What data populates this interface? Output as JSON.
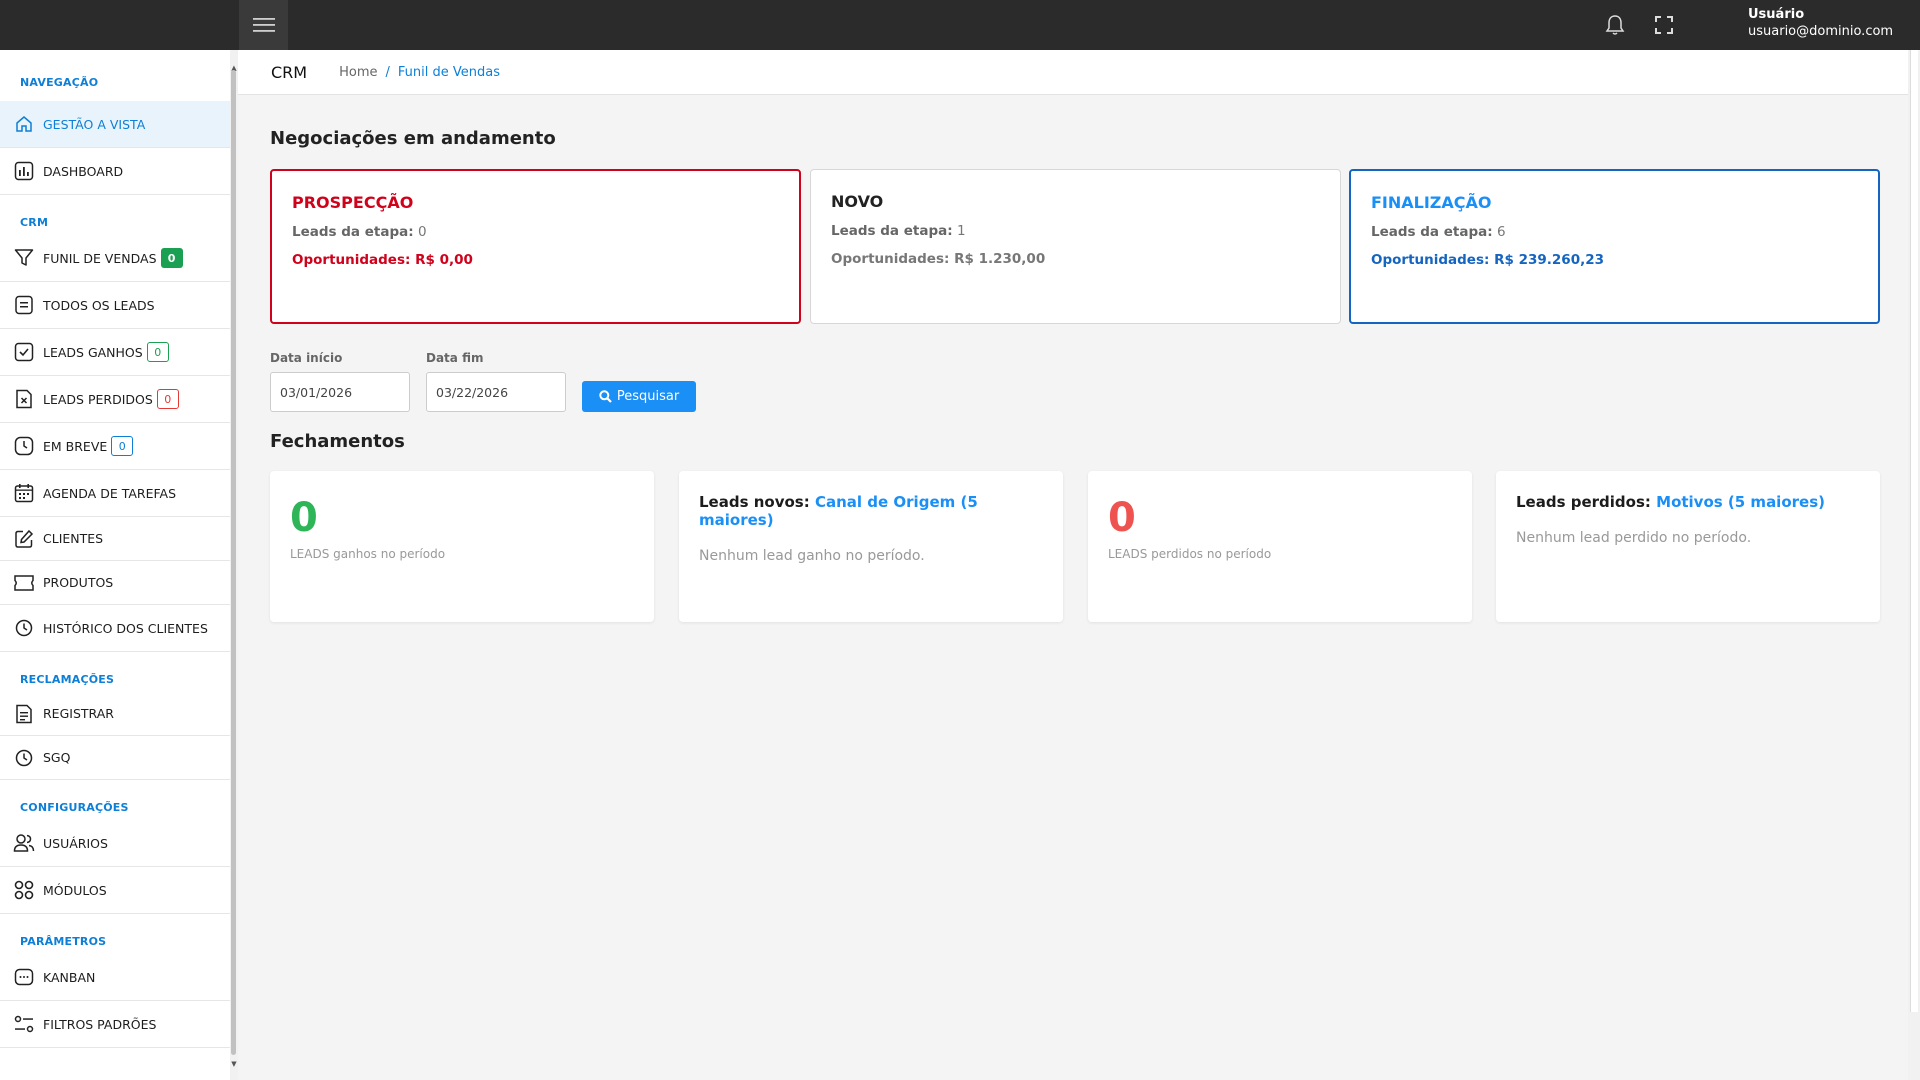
{
  "topbar": {
    "user_name": "Usuário",
    "user_email": "usuario@dominio.com",
    "icons": [
      "menu-icon",
      "bell-icon",
      "fullscreen-icon"
    ]
  },
  "sidebar": {
    "sections": {
      "navegacao": "NAVEGAÇÃO",
      "crm": "CRM",
      "reclamacoes": "RECLAMAÇÕES",
      "configuracoes": "CONFIGURAÇÕES",
      "parametros": "PARÂMETROS"
    },
    "items": {
      "gestao": "GESTÃO A VISTA",
      "dashboard": "DASHBOARD",
      "funil": "FUNIL DE VENDAS",
      "todos_leads": "TODOS OS LEADS",
      "leads_ganhos": "LEADS GANHOS",
      "leads_perdidos": "LEADS PERDIDOS",
      "em_breve": "EM BREVE",
      "agenda": "AGENDA DE TAREFAS",
      "clientes": "CLIENTES",
      "produtos": "PRODUTOS",
      "historico": "HISTÓRICO DOS CLIENTES",
      "registrar": "REGISTRAR",
      "sgq": "SGQ",
      "usuarios": "USUÁRIOS",
      "modulos": "MÓDULOS",
      "kanban": "KANBAN",
      "filtros": "FILTROS PADRÕES"
    },
    "badges": {
      "funil": "0",
      "leads_ganhos": "0",
      "leads_perdidos": "0",
      "em_breve": "0"
    }
  },
  "header": {
    "title": "CRM",
    "breadcrumb_home": "Home",
    "breadcrumb_sep": "/",
    "breadcrumb_current": "Funil de Vendas"
  },
  "negotiations": {
    "title": "Negociações em andamento",
    "leads_label": "Leads da etapa:",
    "opp_label": "Oportunidades:",
    "stages": [
      {
        "name": "PROSPECÇÃO",
        "leads": "0",
        "opportunities": "R$ 0,00",
        "color": "#d0021b"
      },
      {
        "name": "NOVO",
        "leads": "1",
        "opportunities": "R$ 1.230,00",
        "color": "#222222"
      },
      {
        "name": "FINALIZAÇÃO",
        "leads": "6",
        "opportunities": "R$ 239.260,23",
        "color": "#1565c0"
      }
    ]
  },
  "filters": {
    "start_label": "Data início",
    "start_value": "03/01/2026",
    "end_label": "Data fim",
    "end_value": "03/22/2026",
    "search_label": "Pesquisar"
  },
  "closings": {
    "title": "Fechamentos",
    "won_count": "0",
    "won_caption": "LEADS ganhos no período",
    "new_title": "Leads novos:",
    "new_highlight": "Canal de Origem (5 maiores)",
    "new_empty": "Nenhum lead ganho no período.",
    "lost_count": "0",
    "lost_caption": "LEADS perdidos no período",
    "lost_title": "Leads perdidos:",
    "lost_highlight": "Motivos (5 maiores)",
    "lost_empty": "Nenhum lead perdido no período."
  },
  "colors": {
    "accent": "#0d7fd6",
    "button": "#1a8ff5",
    "success": "#2db558",
    "danger": "#ef5350"
  }
}
